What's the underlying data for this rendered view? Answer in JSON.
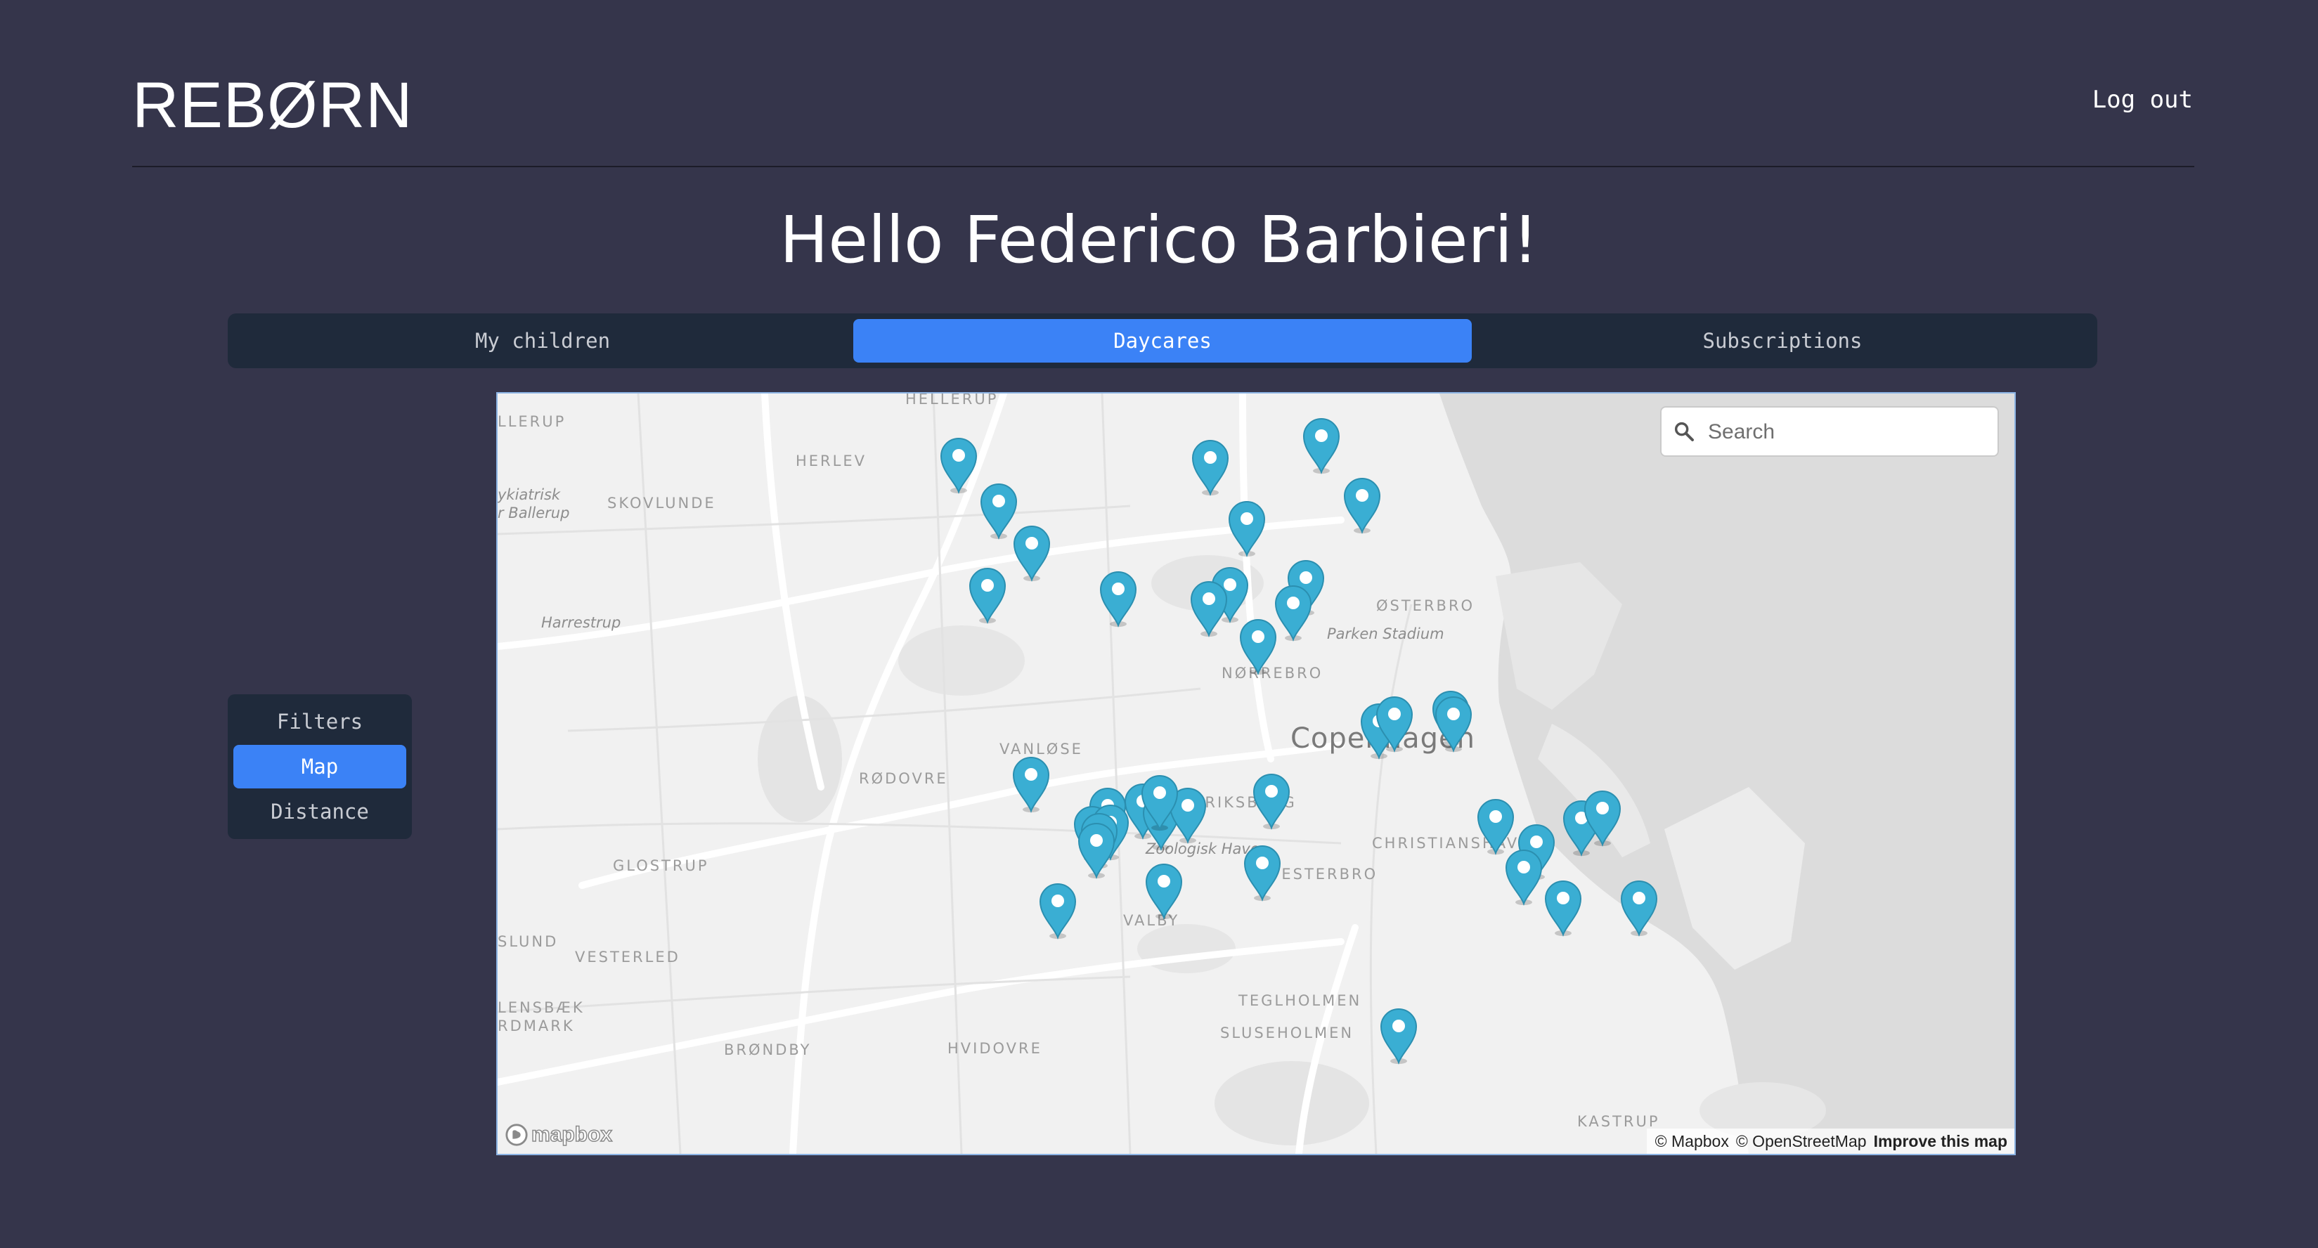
{
  "header": {
    "logo": "REBØRN",
    "logout_label": "Log out"
  },
  "greeting": "Hello Federico Barbieri!",
  "tabs": [
    {
      "label": "My children",
      "active": false
    },
    {
      "label": "Daycares",
      "active": true
    },
    {
      "label": "Subscriptions",
      "active": false
    }
  ],
  "sidenav": [
    {
      "label": "Filters",
      "active": false
    },
    {
      "label": "Map",
      "active": true
    },
    {
      "label": "Distance",
      "active": false
    }
  ],
  "map": {
    "search_placeholder": "Search",
    "labels": {
      "hellerup": "HELLERUP",
      "llerup": "LLERUP",
      "herlev": "HERLEV",
      "skovlunde": "SKOVLUNDE",
      "psykiatrisk_1": "ykiatrisk",
      "psykiatrisk_2": "r Ballerup",
      "harrestrup": "Harrestrup",
      "osterbro": "ØSTERBRO",
      "parken": "Parken Stadium",
      "norrebro": "NØRREBRO",
      "copenhagen": "Copenhagen",
      "vanlose": "VANLØSE",
      "rodovre": "RØDOVRE",
      "frederiksberg": "FREDERIKSBERG",
      "zoo": "Zoologisk Have",
      "christianshavn": "CHRISTIANSHAVN",
      "glostrup": "GLOSTRUP",
      "vesterbro": "VESTERBRO",
      "valby": "VALBY",
      "slund": "SLUND",
      "vesterled": "VESTERLED",
      "lensbaek": "LENSBÆK",
      "rdmark": "RDMARK",
      "brondby": "BRØNDBY",
      "hvidovre": "HVIDOVRE",
      "teglholmen": "TEGLHOLMEN",
      "sluseholmen": "SLUSEHOLMEN",
      "kastrup": "KASTRUP"
    },
    "marker_color": "#3aaed3",
    "marker_count": 40,
    "attribution": {
      "mapbox": "© Mapbox",
      "osm": "© OpenStreetMap",
      "improve": "Improve this map"
    },
    "logo": "mapbox"
  },
  "colors": {
    "background": "#35354b",
    "panel": "#1f2a3b",
    "accent": "#3b82f6"
  }
}
